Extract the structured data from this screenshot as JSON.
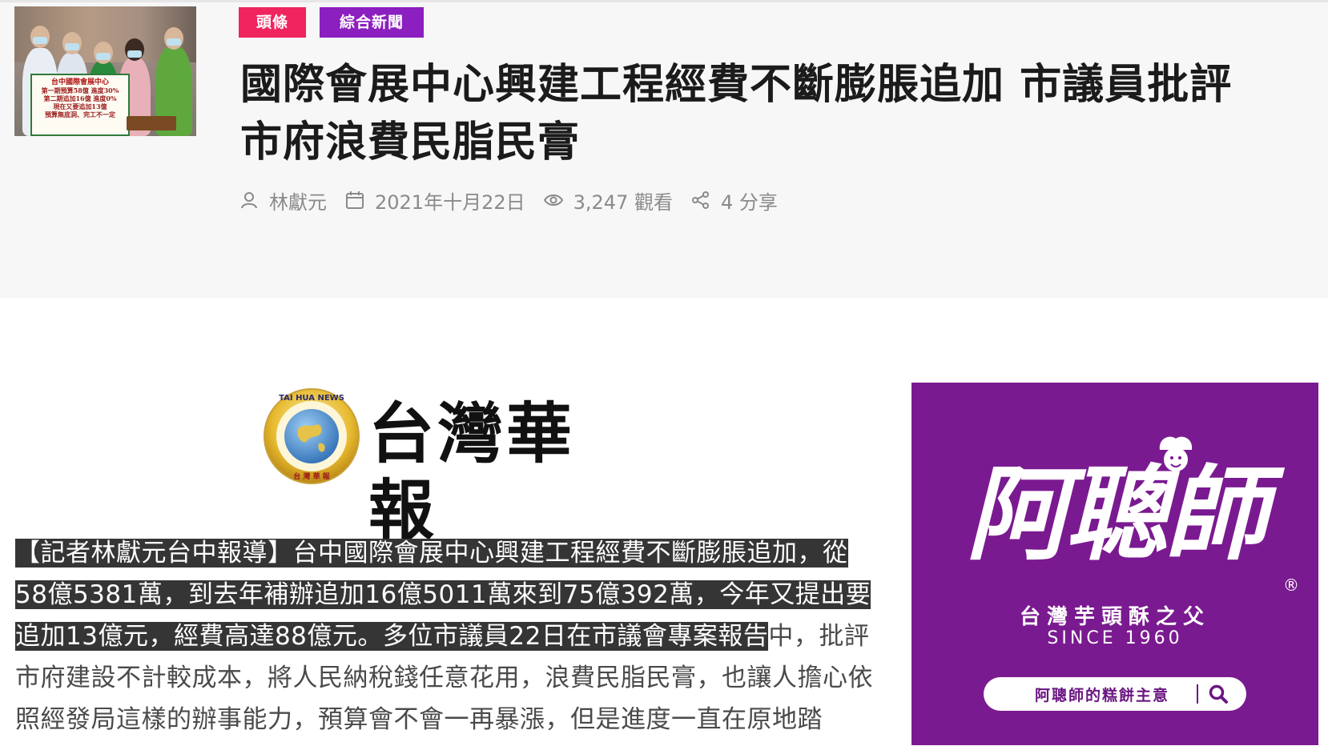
{
  "header": {
    "tags": [
      {
        "label": "頭條",
        "color": "#f0245e"
      },
      {
        "label": "綜合新聞",
        "color": "#8c1fc0"
      }
    ],
    "title_lines": [
      "國際會展中心興建工程經費不斷膨脹追加 市議員批評",
      "市府浪費民脂民膏"
    ],
    "meta": {
      "author": "林獻元",
      "date": "2021年十月22日",
      "views": "3,247 觀看",
      "shares": "4 分享",
      "icons": [
        "user-icon",
        "calendar-icon",
        "eye-icon",
        "share-icon"
      ]
    }
  },
  "thumbnail": {
    "sign_lines": [
      "台中國際會展中心",
      "第一期預算58億 進度30%",
      "第二期追加16億 進度0%",
      "現在又要追加13億",
      "預算無底洞、完工不一定"
    ]
  },
  "logo": {
    "text": "台灣華報",
    "emblem_top": "TAI HUA NEWS",
    "emblem_bottom": "台 灣 華 報"
  },
  "article": {
    "highlighted": "【記者林獻元台中報導】台中國際會展中心興建工程經費不斷膨脹追加，從58億5381萬，到去年補辦追加16億5011萬來到75億392萬，今年又提出要追加13億元，經費高達88億元。多位市議員22日在市議會專案報告",
    "rest": "中，批評市府建設不計較成本，將人民納稅錢任意花用，浪費民脂民膏，也讓人擔心依照經發局這樣的辦事能力，預算會不會一再暴漲，但是進度一直在原地踏"
  },
  "ad": {
    "brand": "阿聰師",
    "registered": "®",
    "slogan": "台灣芋頭酥之父",
    "since": "SINCE 1960",
    "search_label": "阿聰師的糕餅主意",
    "background": "#7a1a90"
  }
}
